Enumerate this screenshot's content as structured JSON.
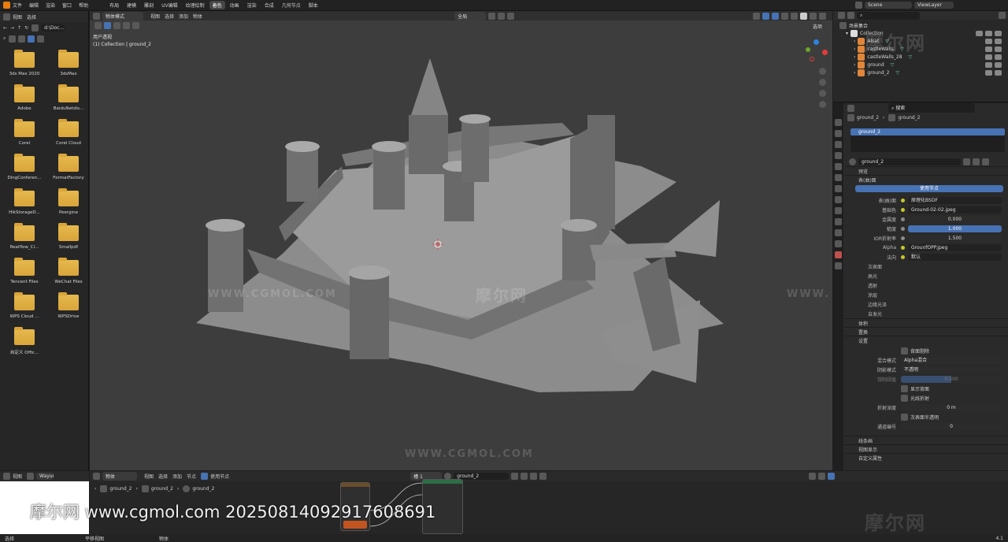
{
  "top_menu": [
    "文件",
    "编辑",
    "渲染",
    "窗口",
    "帮助"
  ],
  "workspace_tabs": [
    "布局",
    "建模",
    "雕刻",
    "UV编辑",
    "纹理绘制",
    "着色",
    "动画",
    "渲染",
    "合成",
    "几何节点",
    "脚本"
  ],
  "active_tab_index": 5,
  "scene": {
    "name": "Scene",
    "view_layer": "ViewLayer"
  },
  "file_browser": {
    "menus": [
      "视图",
      "选择"
    ],
    "path": "d:\\Doc...",
    "items": [
      "3ds Max 2020",
      "3dsMax",
      "Adobe",
      "BaiduNetdis...",
      "Corel",
      "Corel Cloud",
      "DingConferen...",
      "FormatFactory",
      "HikStorageD...",
      "Peergine",
      "Realflow_Cl...",
      "Smallpdf",
      "Tencent Files",
      "WeChat Files",
      "WPS Cloud ...",
      "WPSDrive",
      "自定义 Offic..."
    ]
  },
  "viewport": {
    "mode": "物体模式",
    "menus": [
      "视图",
      "选择",
      "添加",
      "物体"
    ],
    "transform": "全局",
    "view_label": "用户透视",
    "collection_label": "(1) Collection | ground_2",
    "options": "选项",
    "watermark": "WWW.CGMOL.COM"
  },
  "outliner": {
    "title": "场景集合",
    "collection": "Collection",
    "items": [
      "Alsat",
      "castleWalls",
      "castleWalls_28",
      "ground",
      "ground_2"
    ]
  },
  "properties": {
    "search_placeholder": "搜索",
    "breadcrumb": [
      "ground_2",
      "ground_2"
    ],
    "slot": "ground_2",
    "material": "ground_2",
    "preview": "预览",
    "surface_header": "表(曲)面",
    "use_nodes": "使用节点",
    "rows": [
      {
        "label": "表(曲)面",
        "value": "原理化BSDF",
        "type": "link"
      },
      {
        "label": "基础色",
        "value": "Ground-02-02.jpeg",
        "type": "link"
      },
      {
        "label": "金属度",
        "value": "0.000",
        "type": "num"
      },
      {
        "label": "糙度",
        "value": "1.000",
        "type": "blue"
      },
      {
        "label": "IOR折射率",
        "value": "1.500",
        "type": "num"
      },
      {
        "label": "Alpha",
        "value": "GrounfOPP.jpeg",
        "type": "link"
      },
      {
        "label": "法向",
        "value": "默认",
        "type": "link"
      }
    ],
    "sub_sections": [
      "次表面",
      "高光",
      "透射",
      "涂层",
      "边缘光泽",
      "自发光"
    ],
    "sections_a": [
      "体积",
      "置换",
      "设置"
    ],
    "settings": {
      "backface": "背面剔除",
      "blend_label": "混合模式",
      "blend_value": "Alpha混合",
      "shadow_label": "阴影模式",
      "shadow_value": "不透明",
      "clip_label": "钳制阈值",
      "clip_value": "0.500",
      "show_backface": "显示背面",
      "refraction": "光线折射",
      "refr_depth_label": "折射深度",
      "refr_depth_value": "0 m",
      "sub_trans": "次表面半透明",
      "pass_label": "通道编号",
      "pass_value": "0"
    },
    "sections_b": [
      "线条画",
      "视图显示",
      "自定义属性"
    ]
  },
  "node_editor": {
    "mode": "物体",
    "menus": [
      "视图",
      "选择",
      "添加",
      "节点"
    ],
    "use_nodes": "使用节点",
    "slot": "槽 1",
    "material": "ground_2",
    "breadcrumb": [
      "ground_2",
      "ground_2",
      "ground_2"
    ]
  },
  "bottom_left": {
    "menus": [
      "视图"
    ],
    "name": "Wayun"
  },
  "status": {
    "select": "选择",
    "pan": "平移视图",
    "object": "物体",
    "version": "4.1"
  },
  "overlay_watermark": "摩尔网 www.cgmol.com 20250814092917608691",
  "brand_watermark": "摩尔网",
  "colors": {
    "accent": "#4772b3",
    "folder": "#e0b24a",
    "viewport_bg": "#3d3d3d",
    "node_output": "#c2541f"
  }
}
